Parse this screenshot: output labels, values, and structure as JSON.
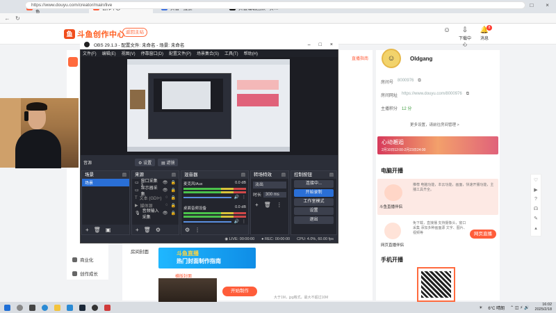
{
  "browser": {
    "tabs": [
      {
        "title": "我的关注 - 斗鱼",
        "color": "#ff5d3a",
        "active": false
      },
      {
        "title": "创作中心",
        "color": "#ff5d3a",
        "active": true
      },
      {
        "title": "抖音 - 搜索",
        "color": "#3b6fe0",
        "active": false
      },
      {
        "title": "抖音编辑团队 - 抖音等下载使用…",
        "color": "#111111",
        "active": false
      }
    ],
    "url": "https://www.douyu.com/creator/main/live",
    "add_tab": "+"
  },
  "douyu": {
    "logo_text": "斗鱼创作中心",
    "back_button": "返回主站",
    "header_icons": [
      {
        "label": "",
        "icon": "avatar-icon"
      },
      {
        "label": "下载中心",
        "icon": "download-icon"
      },
      {
        "label": "消息",
        "icon": "bell-icon",
        "badge": "8"
      }
    ],
    "sidebar": [
      {
        "label": "商业化"
      },
      {
        "label": "创作成长"
      }
    ],
    "user": {
      "name": "Oldgang",
      "room_label": "房间号",
      "room_value": "8000976",
      "link_label": "房间网址",
      "link_value": "https://www.douyu.com/8000976",
      "score_label": "主播积分",
      "score_value": "12 分",
      "more": "更多设置，请前往房间管理 >"
    },
    "promo": {
      "title": "心动邂逅",
      "date": "2月10日12:00-2月23日24:00"
    },
    "pc_live": {
      "title": "电脑开播",
      "app1_name": "斗鱼直播伴侣",
      "app1_desc": "推荐 电脑功能，本云功能，画面，快速开播功能，主播工具齐全。",
      "app2_name": "网页直播伴侣",
      "app2_desc": "免下载，直接播 支持摄像头，窗口采集 添加多种画面源 文字、图片、视频等",
      "web_button": "网页直播"
    },
    "mobile_live": {
      "title": "手机开播"
    },
    "center": {
      "notice_link": "直播指南",
      "room_cover": "房间封面",
      "banner_line1": "斗鱼直播",
      "banner_line2": "热门封面制作指南",
      "cover_hint": "大于1M，jpg格式，最大不超过10M",
      "game_label": "横版封面",
      "start_button": "开始制作"
    }
  },
  "obs": {
    "title": "OBS 29.1.3 - 配置文件: 未命名 - 场景: 未命名",
    "menu": [
      "文件(F)",
      "编辑(E)",
      "视图(V)",
      "停靠窗口(D)",
      "配置文件(P)",
      "场景集合(S)",
      "工具(T)",
      "帮助(H)"
    ],
    "scene_label": "音源",
    "preview_buttons": [
      "设置",
      "滤镜"
    ],
    "docks": {
      "scenes": {
        "title": "场景",
        "items": [
          "场景"
        ]
      },
      "sources": {
        "title": "来源",
        "items": [
          "窗口采集 3",
          "显示器采集",
          "文本 (GDI+)",
          "媒体源",
          "音频输入采集"
        ]
      },
      "mixer": {
        "title": "混音器",
        "tracks": [
          {
            "name": "麦克风/Aux",
            "db": "0.0 dB"
          },
          {
            "name": "桌面音频设备",
            "db": "0.0 dB"
          }
        ]
      },
      "transitions": {
        "title": "转场特效",
        "type": "淡出",
        "duration_label": "时长",
        "duration": "300 ms"
      },
      "controls": {
        "title": "控制按钮",
        "buttons": [
          "连接中...",
          "开始录制",
          "工作室模式",
          "设置",
          "退出"
        ]
      }
    },
    "status": {
      "live": "LIVE: 00:00:00",
      "rec": "REC: 00:00:00",
      "cpu": "CPU: 4.0%, 60.00 fps"
    }
  },
  "taskbar": {
    "weather": "6°C 晴朗",
    "time": "16:02",
    "date": "2025/2/18"
  }
}
